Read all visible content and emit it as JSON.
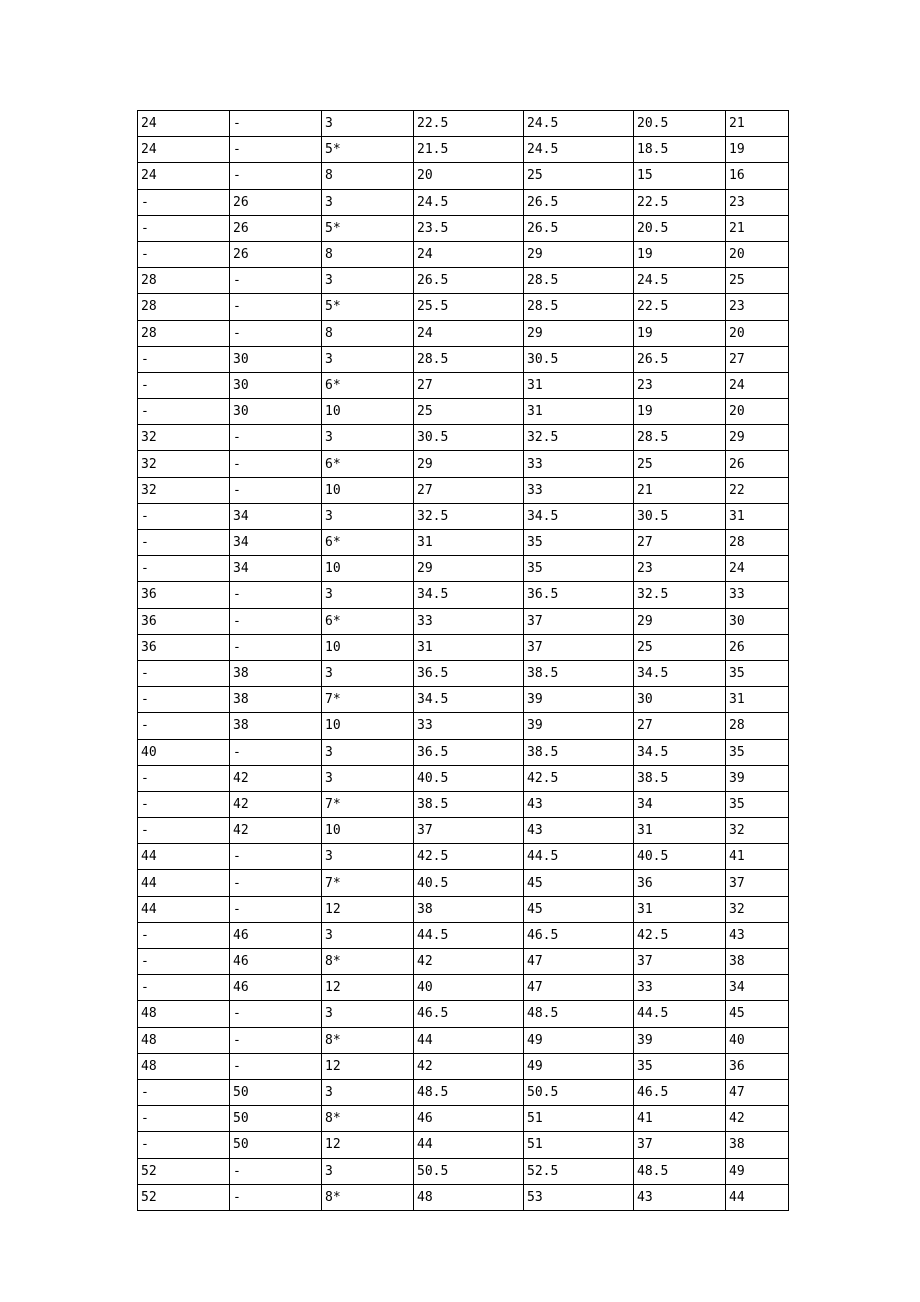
{
  "table": {
    "rows": [
      [
        "24",
        "-",
        "3",
        "22.5",
        "24.5",
        "20.5",
        "21"
      ],
      [
        "24",
        "-",
        "5*",
        "21.5",
        "24.5",
        "18.5",
        "19"
      ],
      [
        "24",
        "-",
        "8",
        "20",
        "25",
        "15",
        "16"
      ],
      [
        "-",
        "26",
        "3",
        "24.5",
        "26.5",
        "22.5",
        "23"
      ],
      [
        "-",
        "26",
        "5*",
        "23.5",
        "26.5",
        "20.5",
        "21"
      ],
      [
        "-",
        "26",
        "8",
        "24",
        "29",
        "19",
        "20"
      ],
      [
        "28",
        "-",
        "3",
        "26.5",
        "28.5",
        "24.5",
        "25"
      ],
      [
        "28",
        "-",
        "5*",
        "25.5",
        "28.5",
        "22.5",
        "23"
      ],
      [
        "28",
        "-",
        "8",
        "24",
        "29",
        "19",
        "20"
      ],
      [
        "-",
        "30",
        "3",
        "28.5",
        "30.5",
        "26.5",
        "27"
      ],
      [
        "-",
        "30",
        "6*",
        "27",
        "31",
        "23",
        "24"
      ],
      [
        "-",
        "30",
        "10",
        "25",
        "31",
        "19",
        "20"
      ],
      [
        "32",
        "-",
        "3",
        "30.5",
        "32.5",
        "28.5",
        "29"
      ],
      [
        "32",
        "-",
        "6*",
        "29",
        "33",
        "25",
        "26"
      ],
      [
        "32",
        "-",
        "10",
        "27",
        "33",
        "21",
        "22"
      ],
      [
        "-",
        "34",
        "3",
        "32.5",
        "34.5",
        "30.5",
        "31"
      ],
      [
        "-",
        "34",
        "6*",
        "31",
        "35",
        "27",
        "28"
      ],
      [
        "-",
        "34",
        "10",
        "29",
        "35",
        "23",
        "24"
      ],
      [
        "36",
        "-",
        "3",
        "34.5",
        "36.5",
        "32.5",
        "33"
      ],
      [
        "36",
        "-",
        "6*",
        "33",
        "37",
        "29",
        "30"
      ],
      [
        "36",
        "-",
        "10",
        "31",
        "37",
        "25",
        "26"
      ],
      [
        "-",
        "38",
        "3",
        "36.5",
        "38.5",
        "34.5",
        "35"
      ],
      [
        "-",
        "38",
        "7*",
        "34.5",
        "39",
        "30",
        "31"
      ],
      [
        "-",
        "38",
        "10",
        "33",
        "39",
        "27",
        "28"
      ],
      [
        "40",
        "-",
        "3",
        "36.5",
        "38.5",
        "34.5",
        "35"
      ],
      [
        "-",
        "42",
        "3",
        "40.5",
        "42.5",
        "38.5",
        "39"
      ],
      [
        "-",
        "42",
        "7*",
        "38.5",
        "43",
        "34",
        "35"
      ],
      [
        "-",
        "42",
        "10",
        "37",
        "43",
        "31",
        "32"
      ],
      [
        "44",
        "-",
        "3",
        "42.5",
        "44.5",
        "40.5",
        "41"
      ],
      [
        "44",
        "-",
        "7*",
        "40.5",
        "45",
        "36",
        "37"
      ],
      [
        "44",
        "-",
        "12",
        "38",
        "45",
        "31",
        "32"
      ],
      [
        "-",
        "46",
        "3",
        "44.5",
        "46.5",
        "42.5",
        "43"
      ],
      [
        "-",
        "46",
        "8*",
        "42",
        "47",
        "37",
        "38"
      ],
      [
        "-",
        "46",
        "12",
        "40",
        "47",
        "33",
        "34"
      ],
      [
        "48",
        "-",
        "3",
        "46.5",
        "48.5",
        "44.5",
        "45"
      ],
      [
        "48",
        "-",
        "8*",
        "44",
        "49",
        "39",
        "40"
      ],
      [
        "48",
        "-",
        "12",
        "42",
        "49",
        "35",
        "36"
      ],
      [
        "-",
        "50",
        "3",
        "48.5",
        "50.5",
        "46.5",
        "47"
      ],
      [
        "-",
        "50",
        "8*",
        "46",
        "51",
        "41",
        "42"
      ],
      [
        "-",
        "50",
        "12",
        "44",
        "51",
        "37",
        "38"
      ],
      [
        "52",
        "-",
        "3",
        "50.5",
        "52.5",
        "48.5",
        "49"
      ],
      [
        "52",
        "-",
        "8*",
        "48",
        "53",
        "43",
        "44"
      ]
    ]
  }
}
